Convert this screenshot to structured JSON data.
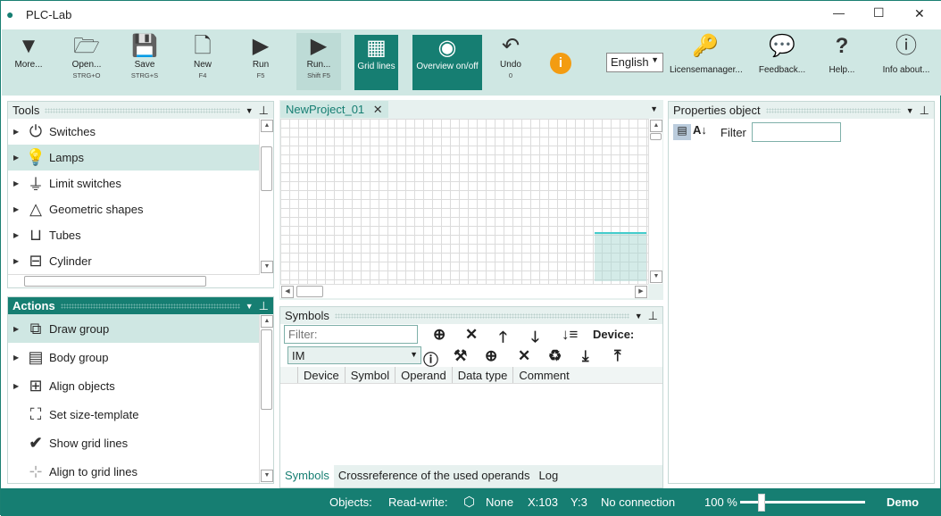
{
  "app": {
    "title": "PLC-Lab"
  },
  "window_controls": {
    "minimize": "—",
    "maximize": "☐",
    "close": "✕"
  },
  "toolbar": [
    {
      "label": "More...",
      "shortcut": "",
      "icon": "triangle-down-icon"
    },
    {
      "label": "Open...",
      "shortcut": "STRG+O",
      "icon": "folder-icon"
    },
    {
      "label": "Save",
      "shortcut": "STRG+S",
      "icon": "save-icon"
    },
    {
      "label": "New",
      "shortcut": "F4",
      "icon": "new-file-icon"
    },
    {
      "label": "Run",
      "shortcut": "F5",
      "icon": "play-icon"
    },
    {
      "label": "Run...",
      "shortcut": "Shift F5",
      "icon": "play-icon"
    },
    {
      "label": "Grid lines",
      "shortcut": "",
      "icon": "grid-icon"
    },
    {
      "label": "Overview on/off",
      "shortcut": "",
      "icon": "hand-icon"
    },
    {
      "label": "Undo",
      "shortcut": "0",
      "icon": "undo-icon"
    },
    {
      "label": "",
      "shortcut": "",
      "icon": "info-icon"
    },
    {
      "label": "Licensemanager...",
      "shortcut": "",
      "icon": "key-icon"
    },
    {
      "label": "Feedback...",
      "shortcut": "",
      "icon": "chat-icon"
    },
    {
      "label": "Help...",
      "shortcut": "",
      "icon": "question-icon"
    },
    {
      "label": "Info about...",
      "shortcut": "",
      "icon": "info-icon"
    }
  ],
  "language": {
    "selected": "English"
  },
  "tools": {
    "title": "Tools",
    "items": [
      {
        "label": "Switches"
      },
      {
        "label": "Lamps"
      },
      {
        "label": "Limit switches"
      },
      {
        "label": "Geometric shapes"
      },
      {
        "label": "Tubes"
      },
      {
        "label": "Cylinder"
      }
    ]
  },
  "actions": {
    "title": "Actions",
    "items": [
      {
        "label": "Draw group"
      },
      {
        "label": "Body group"
      },
      {
        "label": "Align objects"
      },
      {
        "label": "Set size-template"
      },
      {
        "label": "Show grid lines"
      },
      {
        "label": "Align to grid lines"
      }
    ]
  },
  "document": {
    "tab": "NewProject_01",
    "close": "✕"
  },
  "symbols": {
    "title": "Symbols",
    "filter_placeholder": "Filter:",
    "device_label": "Device:",
    "device_value": "IM",
    "columns": [
      "Device",
      "Symbol",
      "Operand",
      "Data type",
      "Comment"
    ],
    "bottom_tabs": [
      "Symbols",
      "Crossreference of the used operands",
      "Log"
    ]
  },
  "properties": {
    "title": "Properties object",
    "filter_label": "Filter",
    "filter_value": ""
  },
  "status": {
    "objects": "Objects:",
    "read_write": "Read-write:",
    "mode": "None",
    "x": "X:103",
    "y": "Y:3",
    "connection": "No connection",
    "zoom": "100 %",
    "zoom_level": 100,
    "edition": "Demo"
  },
  "colors": {
    "accent": "#167e72",
    "toolbar_bg": "#cfe7e3",
    "info_orange": "#f39c12"
  }
}
